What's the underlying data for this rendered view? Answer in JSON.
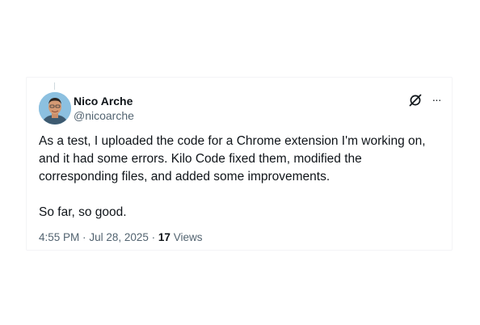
{
  "tweet": {
    "author_name": "Nico Arche",
    "author_handle": "@nicoarche",
    "paragraphs": [
      "As a test, I uploaded the code for a Chrome extension I'm working on, and it had some errors. Kilo Code fixed them, modified the corresponding files, and added some improvements.",
      "So far, so good."
    ],
    "time": "4:55 PM",
    "separator": "·",
    "date": "Jul 28, 2025",
    "views_count": "17",
    "views_label": "Views"
  },
  "icons": {
    "grok": "grok-icon",
    "more": "more-icon",
    "more_glyph": "···"
  },
  "colors": {
    "text": "#0f1419",
    "secondary": "#536471",
    "border": "#f3f4f6"
  }
}
